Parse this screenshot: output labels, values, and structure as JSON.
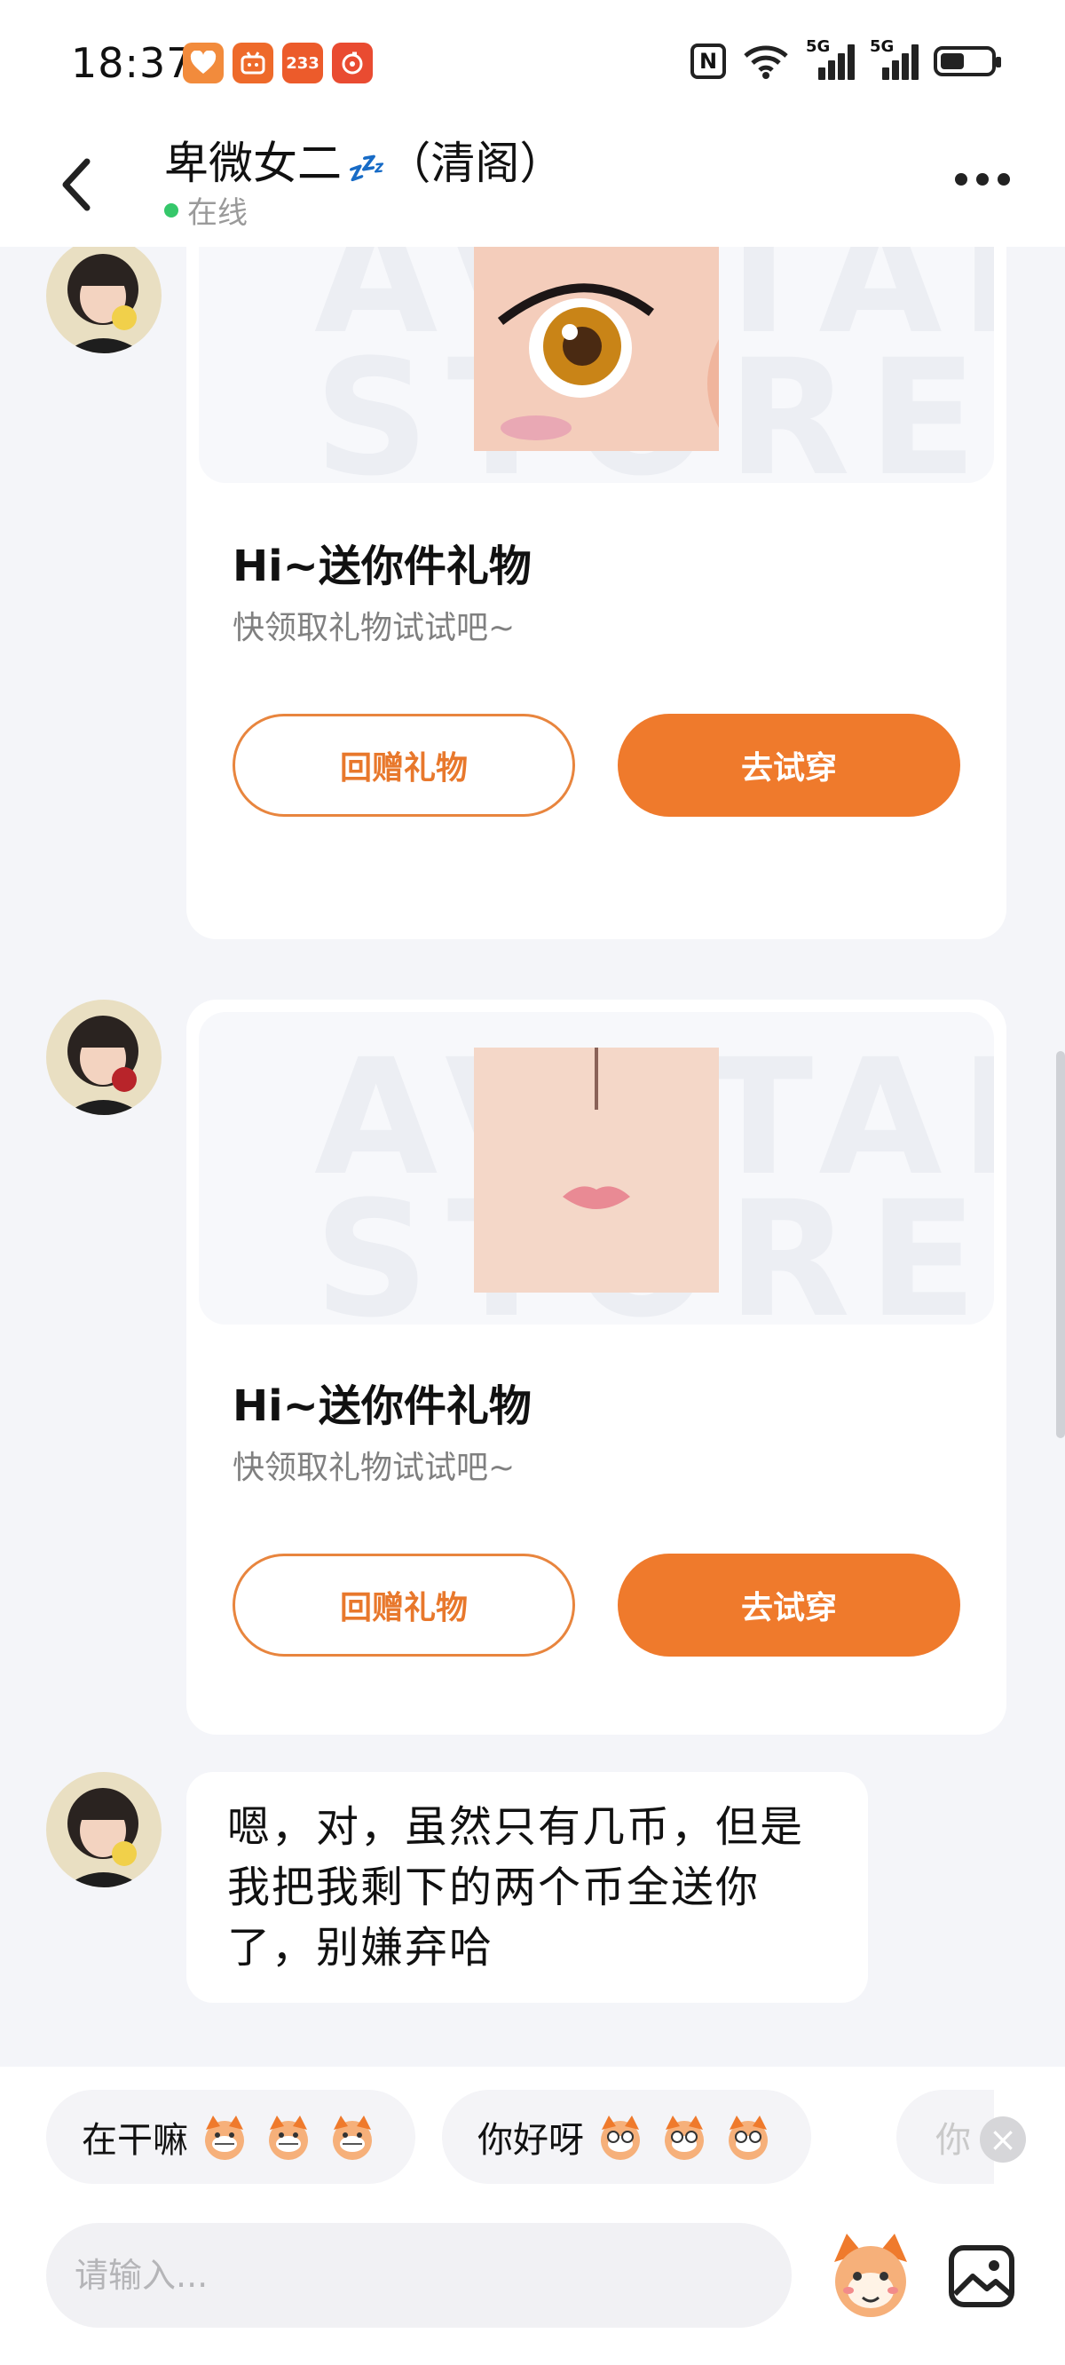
{
  "status_bar": {
    "time": "18:37",
    "app_icons": [
      "heart-app-icon",
      "bilibili-icon",
      "233-icon",
      "music-icon"
    ],
    "app_icon_badge": "233",
    "signal_label_1": "5G",
    "signal_label_2": "5G"
  },
  "header": {
    "title_name": "卑微女二",
    "title_emoji": "💤",
    "title_suffix": "（清阁）",
    "status": "在线"
  },
  "messages": [
    {
      "type": "gift-card",
      "title": "Hi~送你件礼物",
      "subtitle": "快领取礼物试试吧~",
      "watermark": "AVATAR STORE",
      "secondary_button": "回赠礼物",
      "primary_button": "去试穿"
    },
    {
      "type": "gift-card",
      "title": "Hi~送你件礼物",
      "subtitle": "快领取礼物试试吧~",
      "watermark": "AVATAR STORE",
      "secondary_button": "回赠礼物",
      "primary_button": "去试穿"
    },
    {
      "type": "text",
      "lines": [
        "嗯，对，虽然只有几币，但是",
        "我把我剩下的两个币全送你",
        "了，别嫌弃哈"
      ]
    }
  ],
  "quick_replies": [
    {
      "label": "在干嘛"
    },
    {
      "label": "你好呀"
    },
    {
      "label": "你"
    }
  ],
  "composer": {
    "placeholder": "请输入..."
  },
  "colors": {
    "accent": "#EF7A2C",
    "online": "#35C76A",
    "background": "#F4F5F9"
  }
}
